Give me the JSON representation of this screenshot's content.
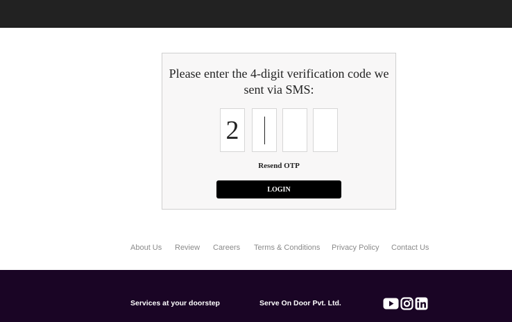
{
  "otp": {
    "prompt": "Please enter the 4-digit verification code we sent via SMS:",
    "digits": [
      "2",
      "",
      "",
      ""
    ],
    "resend_label": "Resend OTP",
    "login_label": "LOGIN"
  },
  "footer": {
    "links": [
      "About Us",
      "Review",
      "Careers",
      "Terms & Conditions",
      "Privacy Policy",
      "Contact Us"
    ],
    "tagline": "Services at your doorstep",
    "company": "Serve On Door Pvt. Ltd.",
    "social": [
      "youtube-icon",
      "instagram-icon",
      "linkedin-icon"
    ]
  },
  "colors": {
    "topbar": "#222222",
    "footer_bg": "#1a0525",
    "button": "#000000"
  }
}
